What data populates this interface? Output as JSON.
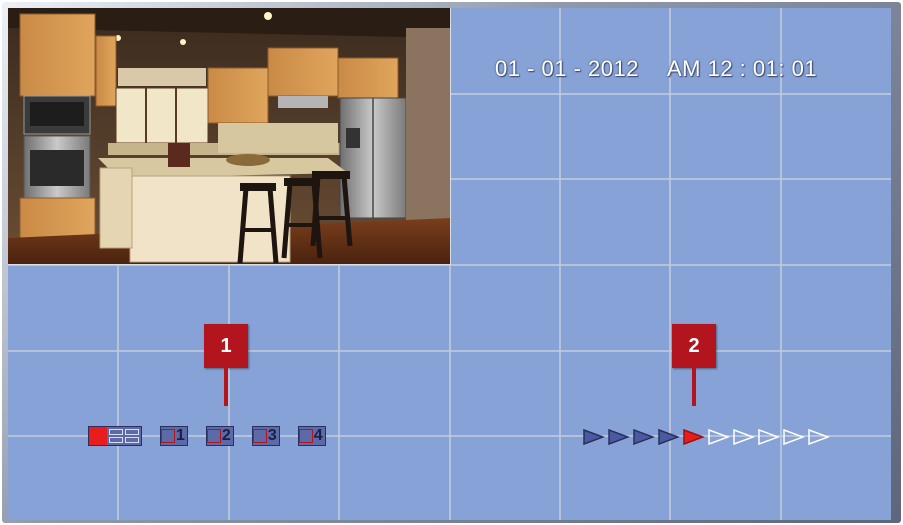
{
  "screen": {
    "date": "01 - 01 - 2012",
    "time": "AM 12 : 01: 01",
    "colors": {
      "background": "#87a2d6",
      "grid": "#c6cdd9",
      "callout": "#b2151e",
      "active": "#e81d1d",
      "button_fill": "#5c6aa8"
    }
  },
  "camera_view": {
    "icon": "kitchen-camera-feed"
  },
  "callouts": [
    {
      "label": "1"
    },
    {
      "label": "2"
    }
  ],
  "layout_buttons": [
    {
      "id": "quad",
      "label": "",
      "selected": true,
      "icon": "quad-split-icon"
    },
    {
      "id": "ch1",
      "label": "1",
      "selected": false
    },
    {
      "id": "ch2",
      "label": "2",
      "selected": false
    },
    {
      "id": "ch3",
      "label": "3",
      "selected": false
    },
    {
      "id": "ch4",
      "label": "4",
      "selected": false
    }
  ],
  "speed_indicator": {
    "total_steps": 10,
    "current_step": 5,
    "icon": "play-arrow-icon"
  }
}
